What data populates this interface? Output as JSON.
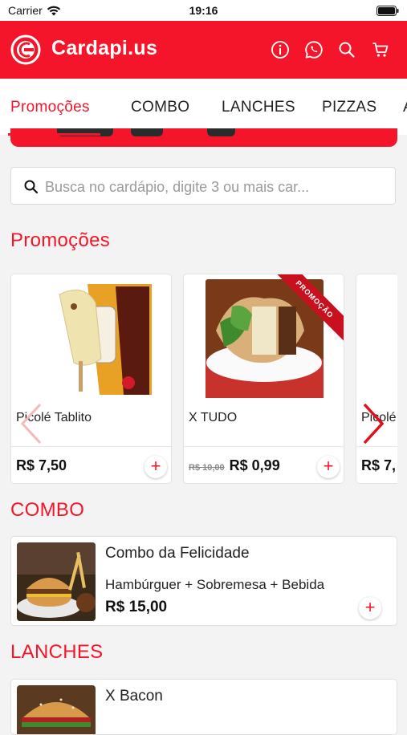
{
  "status_bar": {
    "carrier": "Carrier",
    "time": "19:16"
  },
  "header": {
    "brand": "Cardapi.us",
    "brand_color": "#f4152a",
    "icons": [
      "info-icon",
      "whatsapp-icon",
      "search-icon",
      "cart-icon"
    ]
  },
  "tabs": [
    {
      "label": "Promoções",
      "active": true
    },
    {
      "label": "COMBO"
    },
    {
      "label": "LANCHES"
    },
    {
      "label": "PIZZAS"
    },
    {
      "label": "A"
    }
  ],
  "search": {
    "placeholder": "Busca no cardápio, digite 3 ou mais car..."
  },
  "promotions": {
    "title": "Promoções",
    "items": [
      {
        "name": "Picolé Tablito",
        "price": "R$ 7,50",
        "old_price": "",
        "badge": ""
      },
      {
        "name": "X TUDO",
        "price": "R$ 0,99",
        "old_price": "R$ 10,00",
        "badge": "PROMOÇÃO"
      },
      {
        "name": "Picolé",
        "price": "R$ 7,"
      }
    ]
  },
  "combo": {
    "title": "COMBO",
    "items": [
      {
        "name": "Combo da Felicidade",
        "description": "Hambúrguer + Sobremesa + Bebida",
        "price": "R$ 15,00"
      }
    ]
  },
  "lanches": {
    "title": "LANCHES",
    "items": [
      {
        "name": "X Bacon"
      }
    ]
  },
  "add_symbol": "+"
}
